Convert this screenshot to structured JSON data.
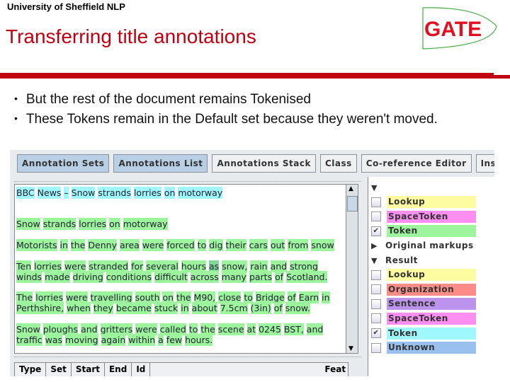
{
  "header": {
    "org": "University of Sheffield NLP",
    "title": "Transferring title annotations",
    "logo_text": "GATE"
  },
  "bullets": [
    "But the rest of the document remains Tokenised",
    "These Tokens remain in the Default set because they weren't moved."
  ],
  "colors": {
    "title_red": "#c00010",
    "token_green": "#9cf59c",
    "token_cyan": "#9ff8fc"
  },
  "tabs": [
    {
      "label": "Annotation Sets",
      "active": true
    },
    {
      "label": "Annotations List",
      "active": true
    },
    {
      "label": "Annotations Stack",
      "active": false
    },
    {
      "label": "Class",
      "active": false
    },
    {
      "label": "Co-reference Editor",
      "active": false
    },
    {
      "label": "Instan",
      "active": false
    }
  ],
  "document": {
    "lines": [
      {
        "text": "BBC News – Snow strands lorries on motorway",
        "hl": "cyan"
      },
      {
        "text": "Snow strands lorries on motorway",
        "hl": "green"
      },
      {
        "text": "Motorists in the Denny area were forced to dig their cars out from snow",
        "hl": "green"
      },
      {
        "text": "Ten lorries were stranded for several hours as snow, rain and strong",
        "hl": "green"
      },
      {
        "text": "winds made driving conditions difficult across many parts of Scotland.",
        "hl": "green"
      },
      {
        "text": "The lorries were travelling south on the M90, close to Bridge of Earn in",
        "hl": "green"
      },
      {
        "text": "Perthshire, when they became stuck in about 7.5cm (3in) of snow.",
        "hl": "green"
      },
      {
        "text": "Snow ploughs and gritters were called to the scene at 0245 BST, and",
        "hl": "green"
      },
      {
        "text": "traffic was moving again within a few hours.",
        "hl": "green"
      }
    ]
  },
  "annotation_sets": [
    {
      "kind": "group",
      "label": "",
      "expanded": true
    },
    {
      "kind": "type",
      "label": "Lookup",
      "checked": false,
      "color": "#fdfca0"
    },
    {
      "kind": "type",
      "label": "SpaceToken",
      "checked": false,
      "color": "#fb8ef0"
    },
    {
      "kind": "type",
      "label": "Token",
      "checked": true,
      "color": "#9cf59c"
    },
    {
      "kind": "group",
      "label": "Original markups",
      "expanded": false
    },
    {
      "kind": "group",
      "label": "Result",
      "expanded": true
    },
    {
      "kind": "type",
      "label": "Lookup",
      "checked": false,
      "color": "#fdfca0"
    },
    {
      "kind": "type",
      "label": "Organization",
      "checked": false,
      "color": "#fb8c88"
    },
    {
      "kind": "type",
      "label": "Sentence",
      "checked": false,
      "color": "#bc94ee"
    },
    {
      "kind": "type",
      "label": "SpaceToken",
      "checked": false,
      "color": "#fb8ef0"
    },
    {
      "kind": "type",
      "label": "Token",
      "checked": true,
      "color": "#9ff8fc"
    },
    {
      "kind": "type",
      "label": "Unknown",
      "checked": false,
      "color": "#99c0ee"
    }
  ],
  "table_headers": [
    "Type",
    "Set",
    "Start",
    "End",
    "Id",
    "Feat"
  ]
}
